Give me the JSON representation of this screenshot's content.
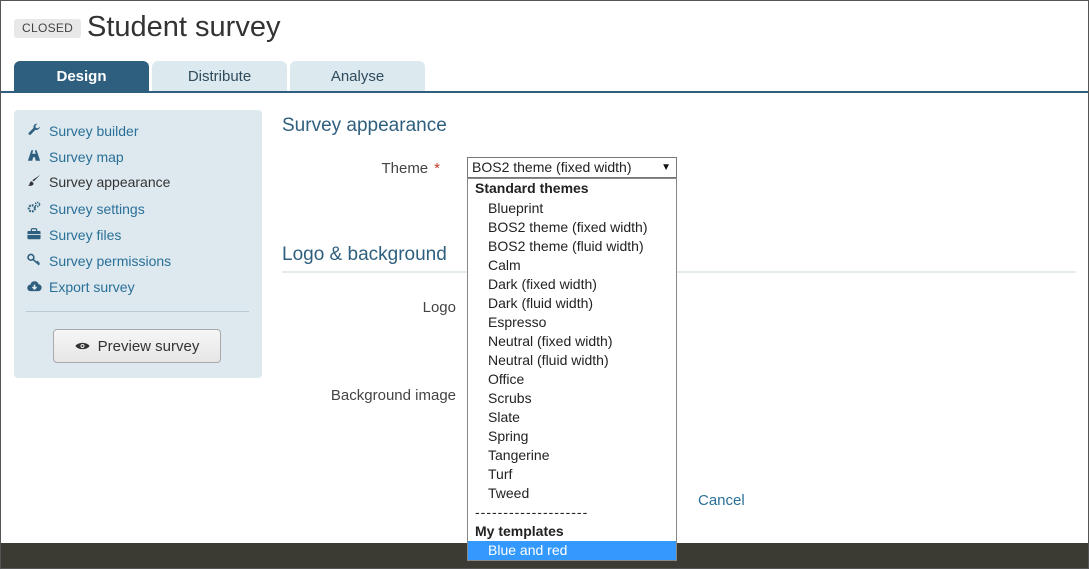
{
  "header": {
    "status": "CLOSED",
    "title": "Student survey"
  },
  "tabs": [
    {
      "label": "Design",
      "active": true
    },
    {
      "label": "Distribute",
      "active": false
    },
    {
      "label": "Analyse",
      "active": false
    }
  ],
  "sidebar": {
    "items": [
      {
        "label": "Survey builder",
        "icon": "wrench-icon"
      },
      {
        "label": "Survey map",
        "icon": "map-icon"
      },
      {
        "label": "Survey appearance",
        "icon": "brush-icon"
      },
      {
        "label": "Survey settings",
        "icon": "gears-icon"
      },
      {
        "label": "Survey files",
        "icon": "briefcase-icon"
      },
      {
        "label": "Survey permissions",
        "icon": "key-icon"
      },
      {
        "label": "Export survey",
        "icon": "cloud-download-icon"
      }
    ],
    "preview_label": "Preview survey"
  },
  "main": {
    "appearance_title": "Survey appearance",
    "theme_label": "Theme",
    "theme_required_mark": "*",
    "theme_value": "BOS2 theme (fixed width)",
    "logo_section_title": "Logo & background",
    "logo_label": "Logo",
    "background_label": "Background image",
    "cancel_label": "Cancel"
  },
  "dropdown": {
    "standard_group": "Standard themes",
    "standard_options": [
      "Blueprint",
      "BOS2 theme (fixed width)",
      "BOS2 theme (fluid width)",
      "Calm",
      "Dark (fixed width)",
      "Dark (fluid width)",
      "Espresso",
      "Neutral (fixed width)",
      "Neutral (fluid width)",
      "Office",
      "Scrubs",
      "Slate",
      "Spring",
      "Tangerine",
      "Turf",
      "Tweed"
    ],
    "separator": "--------------------",
    "templates_group": "My templates",
    "template_options": [
      "Blue and red"
    ],
    "highlighted": "Blue and red"
  },
  "colors": {
    "accent": "#2f5f7f",
    "link": "#2a6f97",
    "highlight": "#3399ff",
    "footer": "#3c3b33"
  }
}
